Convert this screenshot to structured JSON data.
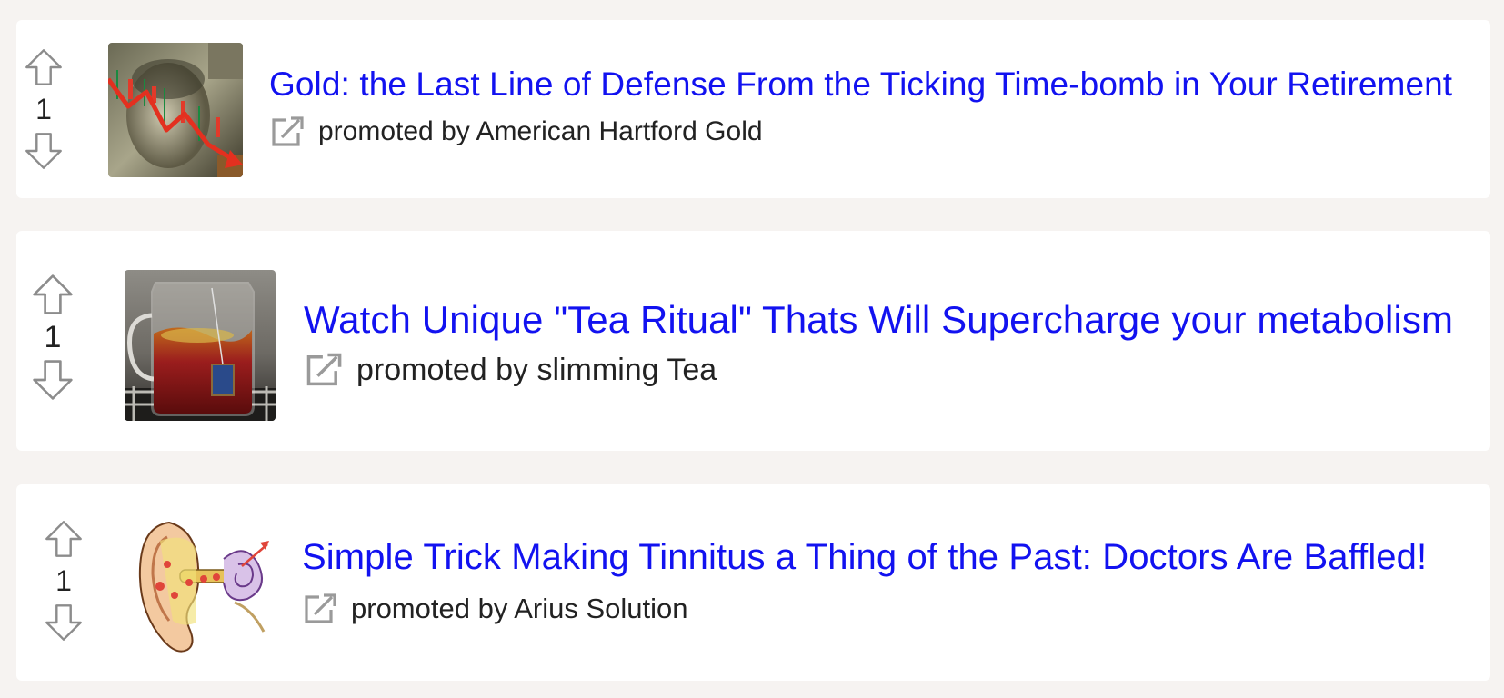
{
  "ads": [
    {
      "votes": "1",
      "title": "Gold: the Last Line of Defense From the Ticking Time-bomb in Your Retirement",
      "promoted_by": "promoted by American Hartford Gold",
      "thumbnail": "gold-dollar-chart-thumbnail"
    },
    {
      "votes": "1",
      "title": "Watch Unique \"Tea Ritual\" Thats Will Supercharge your metabolism",
      "promoted_by": "promoted by slimming Tea",
      "thumbnail": "tea-pitcher-thumbnail"
    },
    {
      "votes": "1",
      "title": "Simple Trick Making Tinnitus a Thing of the Past: Doctors Are Baffled!",
      "promoted_by": "promoted by Arius Solution",
      "thumbnail": "ear-anatomy-thumbnail"
    }
  ],
  "icons": {
    "upvote": "arrow-up-outline-icon",
    "downvote": "arrow-down-outline-icon",
    "external_link": "external-link-icon"
  },
  "colors": {
    "title_link": "#1212f0",
    "page_background": "#f6f3f1",
    "card_background": "#ffffff",
    "icon_gray": "#9a9a9a"
  }
}
